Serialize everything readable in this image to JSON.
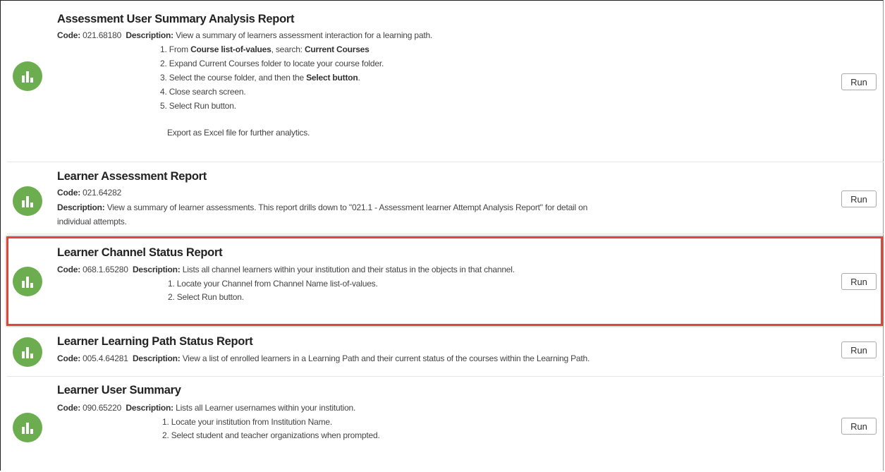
{
  "reports": [
    {
      "title": "Assessment User Summary Analysis Report",
      "code_label": "Code:",
      "code": "021.68180",
      "desc_label": "Description:",
      "desc": "View a summary of learners assessment interaction for a learning path.",
      "steps": [
        {
          "pre": "1. From ",
          "bold": "Course list-of-values",
          "mid": ", search: ",
          "bold2": "Current Courses",
          "post": ""
        },
        {
          "pre": "2. Expand Current Courses folder to locate your course folder.",
          "bold": "",
          "mid": "",
          "bold2": "",
          "post": ""
        },
        {
          "pre": "3. Select the course folder, and then the ",
          "bold": "Select button",
          "mid": ".",
          "bold2": "",
          "post": ""
        },
        {
          "pre": "4. Close search screen.",
          "bold": "",
          "mid": "",
          "bold2": "",
          "post": ""
        },
        {
          "pre": "5. Select Run button.",
          "bold": "",
          "mid": "",
          "bold2": "",
          "post": ""
        }
      ],
      "note": "Export as Excel file for further analytics.",
      "run_label": "Run"
    },
    {
      "title": "Learner Assessment Report",
      "code_label": "Code:",
      "code": "021.64282",
      "desc_label": "Description:",
      "desc_line1": "View a summary of learner assessments. This report drills down to \"021.1 - Assessment learner Attempt Analysis Report\" for detail on",
      "desc_line2": "individual attempts.",
      "run_label": "Run"
    },
    {
      "title": "Learner Channel Status Report",
      "code_label": "Code:",
      "code": "068.1.65280",
      "desc_label": "Description:",
      "desc": "Lists all channel learners within your institution and their status in the objects in that channel.",
      "steps": [
        "1. Locate your Channel from Channel Name list-of-values.",
        "2. Select Run button."
      ],
      "run_label": "Run"
    },
    {
      "title": "Learner Learning Path Status Report",
      "code_label": "Code:",
      "code": "005.4.64281",
      "desc_label": "Description:",
      "desc": "View a list of enrolled learners in a Learning Path and their current status of the courses within the Learning Path.",
      "run_label": "Run"
    },
    {
      "title": "Learner User Summary",
      "code_label": "Code:",
      "code": "090.65220",
      "desc_label": "Description:",
      "desc": "Lists all Learner usernames within your institution.",
      "steps": [
        "1. Locate your institution from Institution Name.",
        "2. Select student and teacher organizations when prompted."
      ],
      "run_label": "Run"
    }
  ],
  "colors": {
    "icon_green": "#6cae4f",
    "highlight_red": "#e0463a"
  },
  "icon_name": "bar-chart-icon"
}
